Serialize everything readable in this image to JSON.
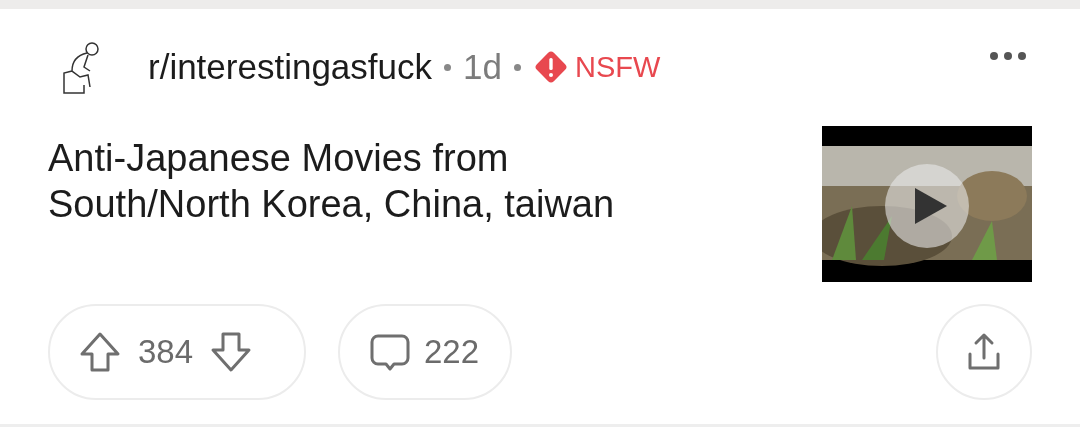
{
  "post": {
    "subreddit": "r/interestingasfuck",
    "age": "1d",
    "nsfw_label": "NSFW",
    "title": "Anti-Japanese Movies from South/North Korea, China, taiwan"
  },
  "actions": {
    "score": "384",
    "comments": "222"
  }
}
